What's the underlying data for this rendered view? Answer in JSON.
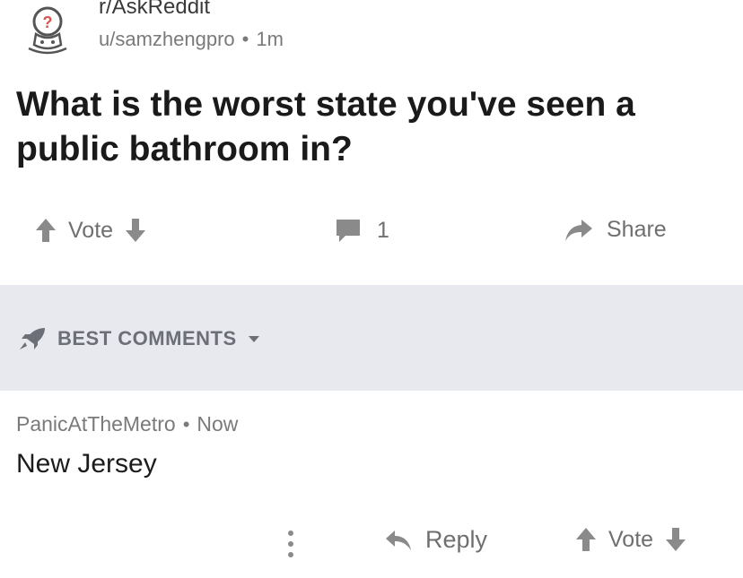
{
  "post": {
    "subreddit": "r/AskReddit",
    "author": "u/samzhengpro",
    "age": "1m",
    "title": "What is the worst state you've seen a public bathroom in?"
  },
  "actions": {
    "vote_label": "Vote",
    "comment_count": "1",
    "share_label": "Share"
  },
  "sort": {
    "label": "BEST COMMENTS"
  },
  "comment": {
    "author": "PanicAtTheMetro",
    "age": "Now",
    "body": "New Jersey",
    "reply_label": "Reply",
    "vote_label": "Vote"
  },
  "colors": {
    "icon_gray": "#8a8a8a",
    "band": "#e8e9ee"
  }
}
